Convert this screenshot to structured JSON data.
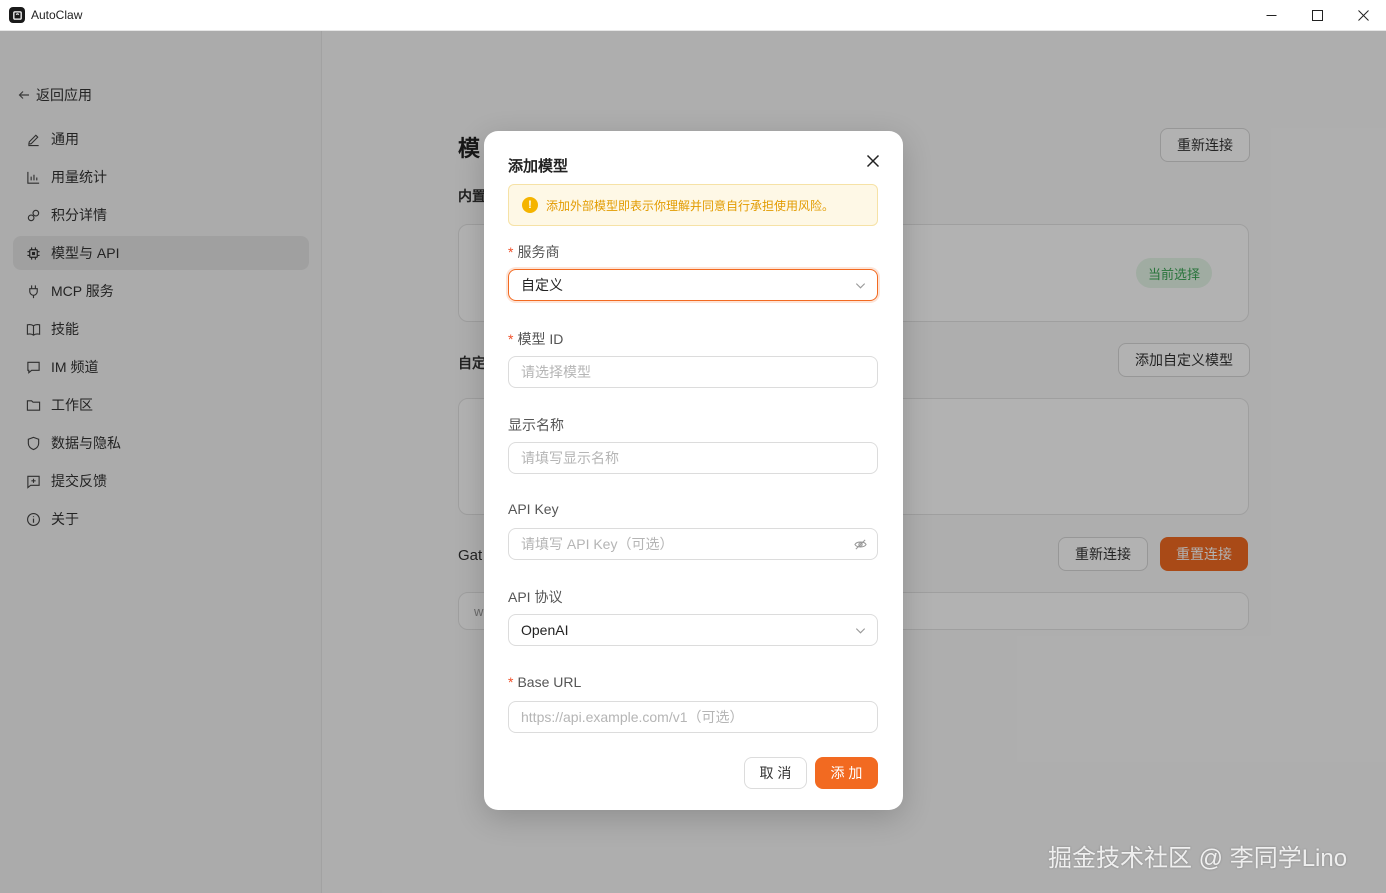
{
  "window": {
    "title": "AutoClaw"
  },
  "sidebar": {
    "back_label": "返回应用",
    "items": [
      {
        "label": "通用",
        "icon": "pen-icon",
        "active": false
      },
      {
        "label": "用量统计",
        "icon": "bar-chart-icon",
        "active": false
      },
      {
        "label": "积分详情",
        "icon": "link-icon",
        "active": false
      },
      {
        "label": "模型与 API",
        "icon": "chip-icon",
        "active": true
      },
      {
        "label": "MCP 服务",
        "icon": "plug-icon",
        "active": false
      },
      {
        "label": "技能",
        "icon": "book-icon",
        "active": false
      },
      {
        "label": "IM 频道",
        "icon": "chat-icon",
        "active": false
      },
      {
        "label": "工作区",
        "icon": "folder-icon",
        "active": false
      },
      {
        "label": "数据与隐私",
        "icon": "shield-icon",
        "active": false
      },
      {
        "label": "提交反馈",
        "icon": "feedback-icon",
        "active": false
      },
      {
        "label": "关于",
        "icon": "info-icon",
        "active": false
      }
    ]
  },
  "main": {
    "title_partial": "模",
    "builtin_label_partial": "内置",
    "custom_label_partial": "自定",
    "gateway_label_partial": "Gat",
    "gateway_value_partial": "w",
    "current_badge": "当前选择",
    "reconnect_top": "重新连接",
    "add_custom_model": "添加自定义模型",
    "reconnect_bottom": "重新连接",
    "reset_connection": "重置连接"
  },
  "modal": {
    "title": "添加模型",
    "warning": "添加外部模型即表示你理解并同意自行承担使用风险。",
    "provider": {
      "label": "服务商",
      "required": true,
      "value": "自定义"
    },
    "model_id": {
      "label": "模型 ID",
      "required": true,
      "placeholder": "请选择模型"
    },
    "display_name": {
      "label": "显示名称",
      "required": false,
      "placeholder": "请填写显示名称"
    },
    "api_key": {
      "label": "API Key",
      "required": false,
      "placeholder": "请填写 API Key（可选）"
    },
    "api_protocol": {
      "label": "API 协议",
      "required": false,
      "value": "OpenAI"
    },
    "base_url": {
      "label": "Base URL",
      "required": true,
      "placeholder": "https://api.example.com/v1（可选）"
    },
    "cancel_label": "取 消",
    "add_label": "添 加"
  },
  "watermark": "掘金技术社区 @ 李同学Lino",
  "colors": {
    "accent": "#f26a21",
    "success": "#3aa655",
    "warning": "#f5b400"
  }
}
